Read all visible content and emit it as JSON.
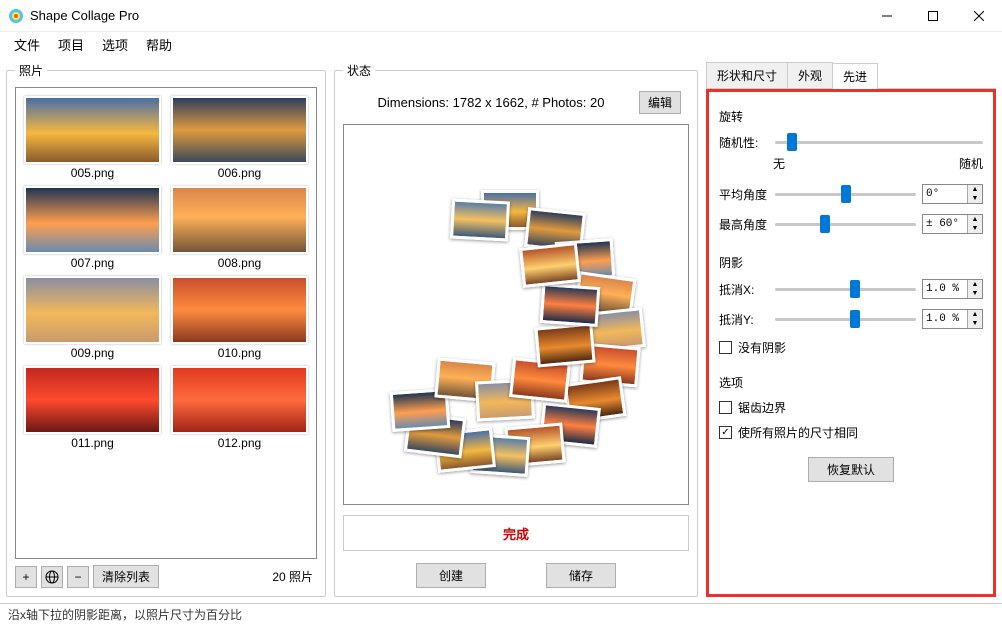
{
  "window": {
    "title": "Shape Collage Pro"
  },
  "menu": {
    "file": "文件",
    "project": "项目",
    "options": "选项",
    "help": "帮助"
  },
  "panes": {
    "photos": "照片",
    "status": "状态"
  },
  "photos": {
    "items": [
      {
        "name": "005.png"
      },
      {
        "name": "006.png"
      },
      {
        "name": "007.png"
      },
      {
        "name": "008.png"
      },
      {
        "name": "009.png"
      },
      {
        "name": "010.png"
      },
      {
        "name": "011.png"
      },
      {
        "name": "012.png"
      }
    ],
    "add": "+",
    "remove": "−",
    "clear": "清除列表",
    "count": "20 照片"
  },
  "status": {
    "dims": "Dimensions: 1782 x 1662, # Photos: 20",
    "edit": "编辑",
    "done": "完成",
    "create": "创建",
    "save": "储存"
  },
  "tabs": {
    "shape": "形状和尺寸",
    "appearance": "外观",
    "advanced": "先进"
  },
  "adv": {
    "rotation_h": "旋转",
    "randomness": "随机性:",
    "min_lbl": "无",
    "max_lbl": "随机",
    "avg_angle": "平均角度",
    "avg_val": "0°",
    "max_angle": "最高角度",
    "max_val": "± 60°",
    "shadow_h": "阴影",
    "offx": "抵消X:",
    "offx_val": "1.0 %",
    "offy": "抵消Y:",
    "offy_val": "1.0 %",
    "no_shadow": "没有阴影",
    "options_h": "选项",
    "jagged": "锯齿边界",
    "same_size": "使所有照片的尺寸相同",
    "restore": "恢复默认"
  },
  "statusbar": "沿x轴下拉的阴影距离，以照片尺寸为百分比"
}
